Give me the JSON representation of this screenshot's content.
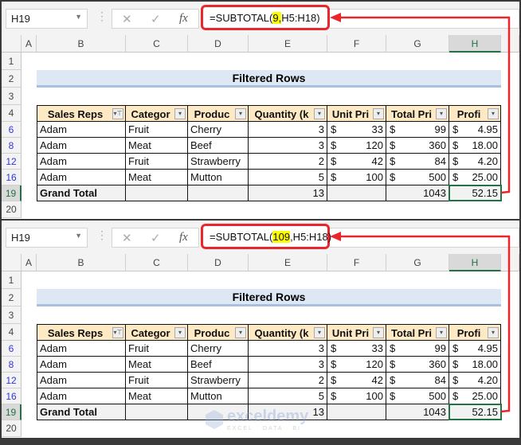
{
  "panels": [
    {
      "name_box": "H19",
      "formula_prefix": "=SUBTOTAL(",
      "formula_highlight": "9,",
      "formula_suffix": "H5:H18)"
    },
    {
      "name_box": "H19",
      "formula_prefix": "=SUBTOTAL(",
      "formula_highlight": "109",
      "formula_suffix": ",H5:H18)"
    }
  ],
  "fx_icons": {
    "cancel": "✕",
    "enter": "✓",
    "fx": "fx"
  },
  "columns": [
    "A",
    "B",
    "C",
    "D",
    "E",
    "F",
    "G",
    "H"
  ],
  "rows": [
    "1",
    "2",
    "3",
    "4",
    "6",
    "8",
    "12",
    "16",
    "19",
    "20"
  ],
  "title": "Filtered Rows",
  "headers": [
    "Sales Reps",
    "Categor",
    "Produc",
    "Quantity (k",
    "Unit Pri",
    "Total Pri",
    "Profi"
  ],
  "data": [
    [
      "Adam",
      "Fruit",
      "Cherry",
      "3",
      "33",
      "99",
      "4.95"
    ],
    [
      "Adam",
      "Meat",
      "Beef",
      "3",
      "120",
      "360",
      "18.00"
    ],
    [
      "Adam",
      "Fruit",
      "Strawberry",
      "2",
      "42",
      "84",
      "4.20"
    ],
    [
      "Adam",
      "Meat",
      "Mutton",
      "5",
      "100",
      "500",
      "25.00"
    ]
  ],
  "currency": "$",
  "grand_total": {
    "label": "Grand Total",
    "quantity": "13",
    "total_price": "1043",
    "profit": "52.15"
  },
  "watermark": {
    "name": "exceldemy",
    "tagline": "EXCEL · DATA · BI"
  },
  "colors": {
    "arrow": "#e8262b",
    "header_bg": "#fde9c4",
    "title_bg": "#dde8f4",
    "selection": "#217346"
  }
}
